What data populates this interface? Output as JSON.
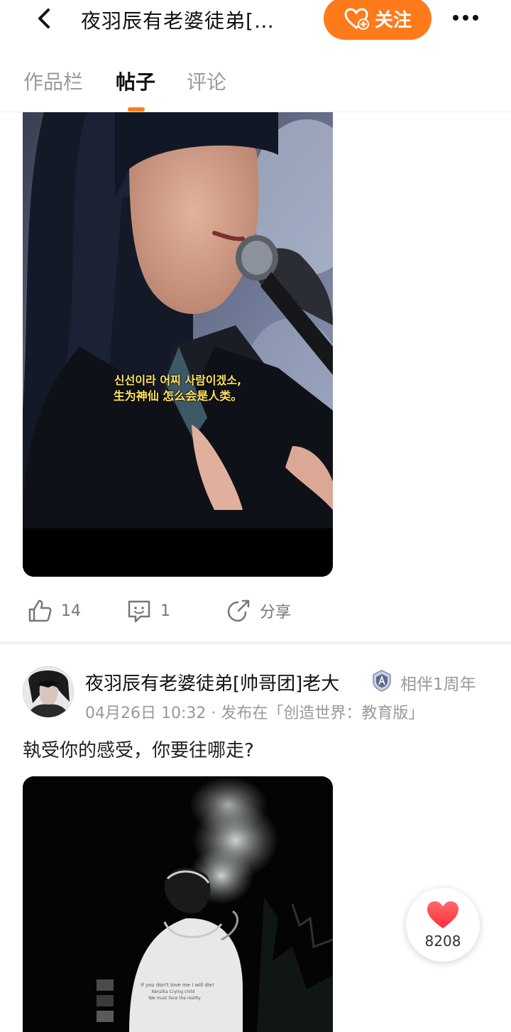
{
  "header": {
    "title": "夜羽辰有老婆徒弟[…",
    "follow_label": "关注"
  },
  "tabs": [
    {
      "label": "作品栏"
    },
    {
      "label": "帖子"
    },
    {
      "label": "评论"
    }
  ],
  "post1": {
    "subtitle_line1": "신선이라 어찌 사람이겠소,",
    "subtitle_line2": "生为神仙 怎么会是人类。",
    "likes": "14",
    "comments": "1",
    "share_label": "分享"
  },
  "post2": {
    "author": "夜羽辰有老婆徒弟[帅哥团]老大",
    "companion": "相伴1周年",
    "meta": "04月26日 10:32 · 发布在「创造世界：教育版」",
    "text": "執受你的感受，你要往哪走?",
    "shirt_line1": "If you don't love me I will die!",
    "shirt_line2": "Kenzika Crying child",
    "shirt_line3": "We must face the reality"
  },
  "like_float": {
    "count": "8208"
  },
  "colors": {
    "accent": "#ff7a1a",
    "heart": "#ff3b3b"
  }
}
